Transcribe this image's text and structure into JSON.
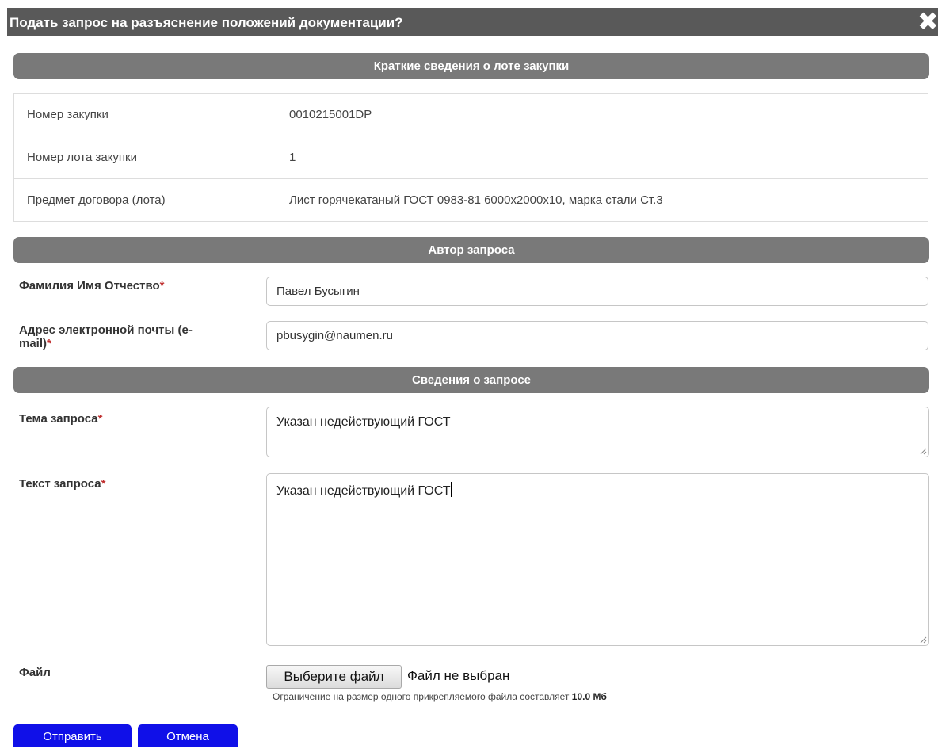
{
  "dialog": {
    "title": "Подать запрос на разъяснение положений документации?",
    "close_symbol": "✖"
  },
  "lot_section": {
    "header": "Краткие сведения о лоте закупки",
    "rows": [
      {
        "label": "Номер закупки",
        "value": "0010215001DP"
      },
      {
        "label": "Номер лота закупки",
        "value": "1"
      },
      {
        "label": "Предмет договора (лота)",
        "value": "Лист горячекатаный ГОСТ 0983-81 6000x2000x10, марка стали Ст.3"
      }
    ]
  },
  "author_section": {
    "header": "Автор запроса",
    "name_label": "Фамилия Имя Отчество",
    "name_value": "Павел Бусыгин",
    "email_label_line1": "Адрес электронной почты (e-",
    "email_label_line2": "mail)",
    "email_value": "pbusygin@naumen.ru",
    "required_mark": "*"
  },
  "request_section": {
    "header": "Сведения о запросе",
    "subject_label": "Тема запроса",
    "subject_value": "Указан недействующий ГОСТ",
    "text_label": "Текст запроса",
    "text_value": "Указан недействующий ГОСТ",
    "required_mark": "*"
  },
  "file_section": {
    "label": "Файл",
    "choose_button": "Выберите файл",
    "status": "Файл не выбран",
    "hint_prefix": "Ограничение на размер одного прикрепляемого файла составляет",
    "hint_limit": "10.0 Мб"
  },
  "actions": {
    "submit_label": "Отправить",
    "cancel_label": "Отмена"
  },
  "colors": {
    "titlebar": "#595959",
    "section_header": "#797979",
    "action_button": "#1010e8",
    "required": "#c03030"
  }
}
